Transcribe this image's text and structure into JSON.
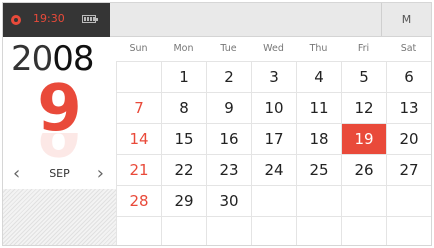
{
  "status": {
    "time": "19:30"
  },
  "topbar": {
    "mode_label": "M"
  },
  "left": {
    "year_prefix": "20",
    "year_suffix": "08",
    "day": "9",
    "month": "SEP",
    "prev": "‹",
    "next": "›"
  },
  "weekdays": [
    "Sun",
    "Mon",
    "Tue",
    "Wed",
    "Thu",
    "Fri",
    "Sat"
  ],
  "weeks": [
    [
      "",
      "1",
      "2",
      "3",
      "4",
      "5",
      "6"
    ],
    [
      "7",
      "8",
      "9",
      "10",
      "11",
      "12",
      "13"
    ],
    [
      "14",
      "15",
      "16",
      "17",
      "18",
      "19",
      "20"
    ],
    [
      "21",
      "22",
      "23",
      "24",
      "25",
      "26",
      "27"
    ],
    [
      "28",
      "29",
      "30",
      "",
      "",
      "",
      ""
    ],
    [
      "",
      "",
      "",
      "",
      "",
      "",
      ""
    ]
  ],
  "selected": "19",
  "colors": {
    "accent": "#e94a3a",
    "statusbar": "#353535"
  }
}
